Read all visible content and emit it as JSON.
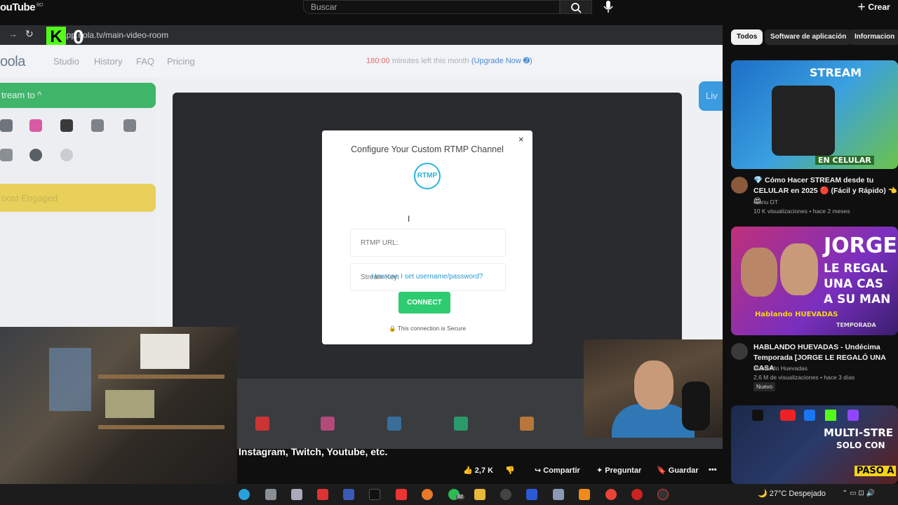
{
  "youtube": {
    "logo": "ouTube",
    "logo_region": "BO",
    "search_placeholder": "Buscar",
    "create_label": "Crear",
    "video_caption": "Instagram, Twitch, Youtube, etc.",
    "actions": {
      "likes": "2,7 K",
      "share": "Compartir",
      "ask": "Preguntar",
      "save": "Guardar"
    },
    "chips": [
      "Todos",
      "Software de aplicación",
      "Informacion"
    ],
    "recommendations": [
      {
        "thumb_text_1": "STREAM",
        "thumb_text_2": "EN CELULAR",
        "title": "💎 Cómo Hacer STREAM desde tu CELULAR en 2025 🔴 (Fácil y Rápido) 👈😍",
        "channel": "manu DT",
        "meta": "10 K visualizaciones • hace 2 meses"
      },
      {
        "thumb_text_1": "JORGE",
        "thumb_text_2": "LE REGAL",
        "thumb_text_3": "UNA CAS",
        "thumb_text_4": "A SU MAN",
        "thumb_text_5": "TEMPORADA",
        "thumb_text_6": "Hablando HUEVADAS",
        "title": "HABLANDO HUEVADAS - Undécima Temporada [JORGE LE REGALÓ UNA CASA",
        "channel": "Hablando Huevadas",
        "meta": "2,6 M de visualizaciones • hace 3 días",
        "badge": "Nuevo"
      },
      {
        "thumb_text_1": "MULTI-STRE",
        "thumb_text_2": "SOLO CON",
        "thumb_text_3": "PASO A"
      }
    ]
  },
  "embedded_browser": {
    "url": "app.oola.tv/main-video-room",
    "kick_count": "0"
  },
  "app": {
    "logo": "oola",
    "nav": [
      "Studio",
      "History",
      "FAQ",
      "Pricing"
    ],
    "minutes_value": "180:00",
    "minutes_text": " minutes left this month ",
    "upgrade": "(Upgrade Now ➋)",
    "stream_to": "tream to ^",
    "boost": "oost Engaged",
    "live_btn": "Liv"
  },
  "modal": {
    "title": "Configure Your Custom RTMP Channel",
    "logo_text": "RTMP",
    "rtmp_url_placeholder": "RTMP URL:",
    "stream_key_placeholder": "Stream Key:",
    "help_link": "How can I set username/password?",
    "connect_label": "CONNECT",
    "secure_text": "This connection is Secure",
    "close": "×"
  },
  "taskbar": {
    "weather": "27°C Despejado",
    "badge": "82"
  },
  "colors": {
    "kick_green": "#53fc18",
    "connect_green": "#2ecc71",
    "rtmp_blue": "#2cb3d8",
    "link_blue": "#2a9bd0"
  }
}
